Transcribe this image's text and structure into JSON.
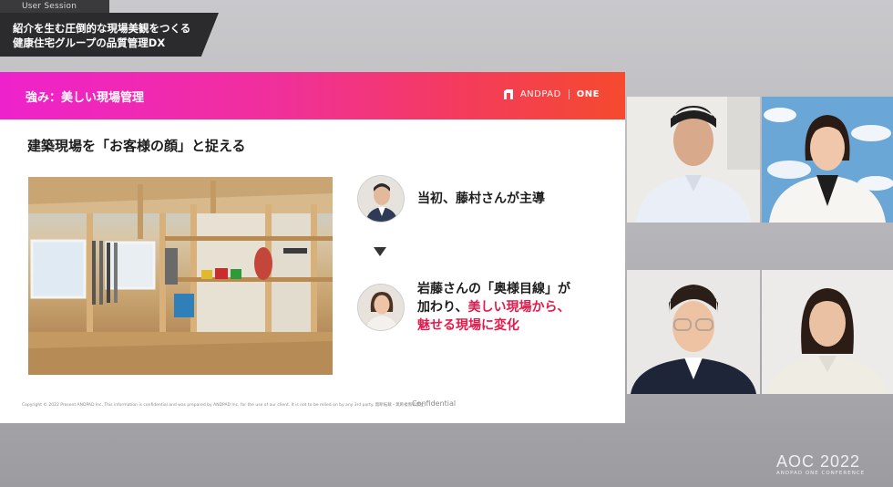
{
  "session": {
    "tag": "User Session",
    "title_line1": "紹介を生む圧倒的な現場美観をつくる",
    "title_line2": "健康住宅グループの品質管理DX"
  },
  "slide": {
    "header_title": "強み：美しい現場管理",
    "brand_name": "ANDPAD",
    "brand_one": "ONE",
    "subtitle": "建築現場を「お客様の顔」と捉える",
    "item1_text": "当初、藤村さんが主導",
    "item2_line1": "岩藤さんの「奥様目線」が",
    "item2_line2_prefix": "加わり、",
    "item2_line2_accent": "美しい現場から、",
    "item2_line3_accent": "魅せる現場に変化",
    "copyright": "Copyright © 2022 Present ANDPAD Inc. This information is confidential and was prepared by ANDPAD Inc. for the use of our client. It is not to be relied on by any 3rd party.  無断転載・無断複製の禁止",
    "confidential": "Confidential",
    "accent_color": "#e6194b"
  },
  "conference": {
    "name": "AOC 2022",
    "sub": "ANDPAD ONE CONFERENCE"
  }
}
